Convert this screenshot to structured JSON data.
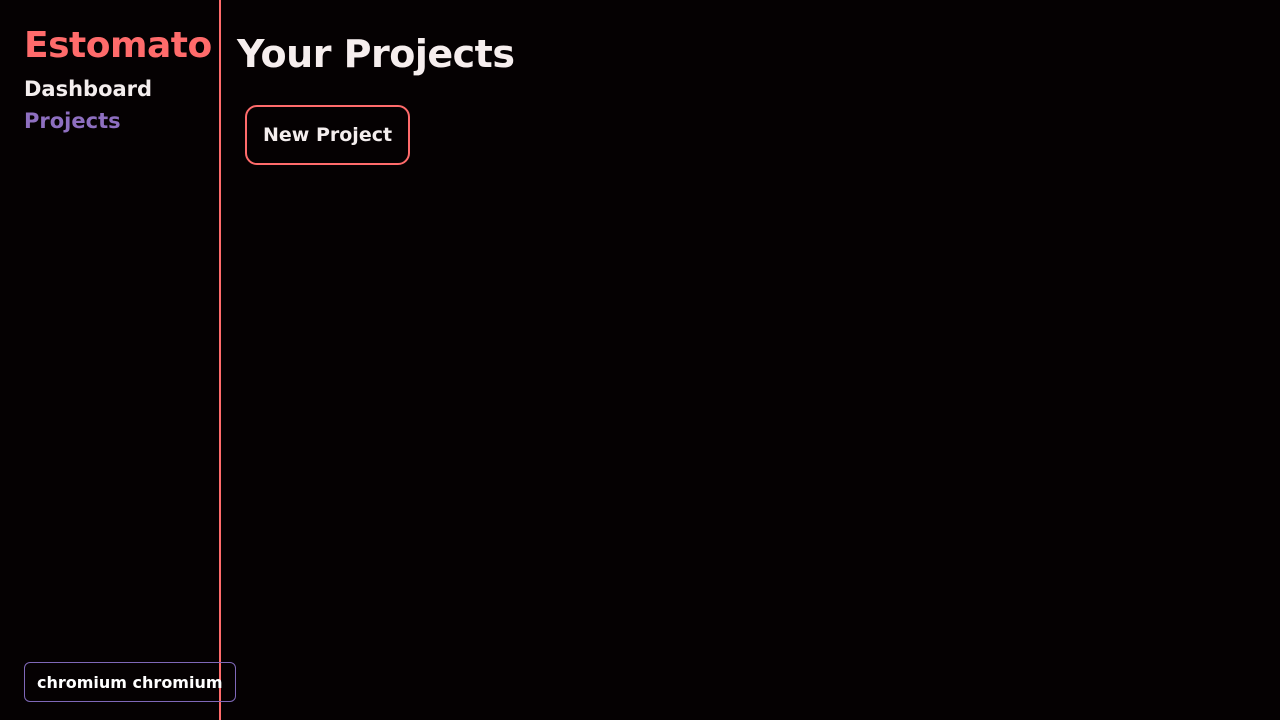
{
  "sidebar": {
    "brand": "Estomato",
    "nav": {
      "dashboard": "Dashboard",
      "projects": "Projects"
    },
    "user": "chromium chromium"
  },
  "main": {
    "title": "Your Projects",
    "new_project_label": "New Project"
  },
  "colors": {
    "background": "#050102",
    "accent": "#ff6b6b",
    "active_nav": "#8e6fc0",
    "text": "#f4eeee",
    "user_border": "#7f68b8"
  }
}
